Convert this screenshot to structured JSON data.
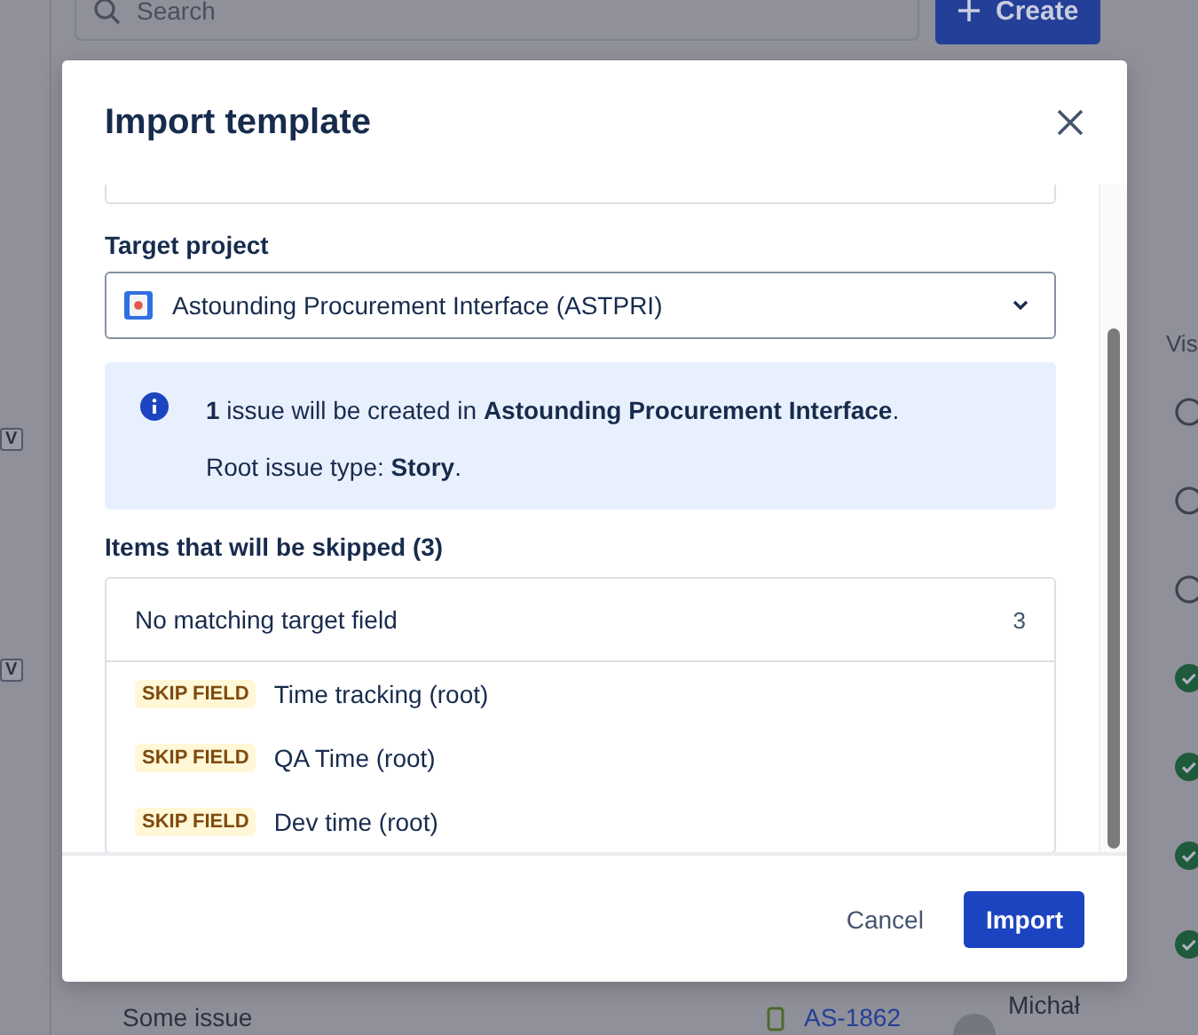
{
  "background": {
    "search": {
      "placeholder": "Search"
    },
    "create_button": "Create",
    "sidebar_badges": [
      "V",
      "V"
    ],
    "column_header": "Vis",
    "status_rows": [
      {
        "done": false
      },
      {
        "done": false
      },
      {
        "done": false
      },
      {
        "done": true
      },
      {
        "done": true
      },
      {
        "done": true
      },
      {
        "done": true
      }
    ],
    "issue_row": {
      "summary": "Some issue",
      "key": "AS-1862",
      "assignee": "Michał"
    }
  },
  "dialog": {
    "title": "Import template",
    "target_project": {
      "label": "Target project",
      "value": "Astounding Procurement Interface (ASTPRI)"
    },
    "info": [
      "**1** issue will be created in **Astounding Procurement Interface**.",
      "Root issue type: **Story**."
    ],
    "skipped": {
      "heading": "Items that will be skipped (3)",
      "group": {
        "title": "No matching target field",
        "count": "3",
        "items": [
          {
            "tag": "SKIP FIELD",
            "name": "Time tracking (root)"
          },
          {
            "tag": "SKIP FIELD",
            "name": "QA Time (root)"
          },
          {
            "tag": "SKIP FIELD",
            "name": "Dev time (root)"
          }
        ]
      }
    },
    "buttons": {
      "cancel": "Cancel",
      "primary": "Import"
    }
  }
}
